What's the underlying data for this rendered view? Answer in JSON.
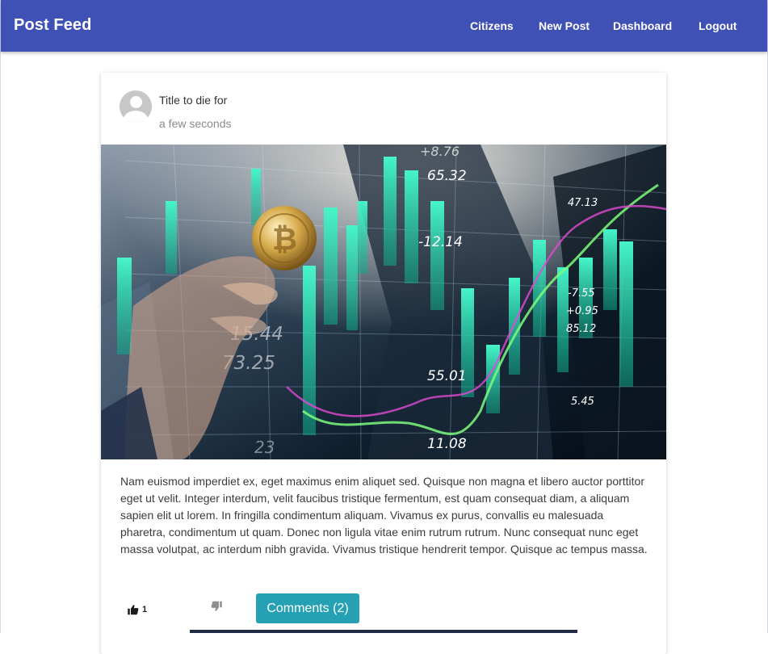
{
  "header": {
    "brand": "Post Feed",
    "nav": [
      "Citizens",
      "New Post",
      "Dashboard",
      "Logout"
    ],
    "background_color": "#3f51b5"
  },
  "post": {
    "title": "Title to die for",
    "time": "a few seconds",
    "avatar_icon": "default-user-avatar",
    "image_overlay_numbers": [
      "+8.76",
      "65.32",
      "-12.14",
      "47.13",
      "-7.55",
      "+0.95",
      "85.12",
      "15.44",
      "73.25",
      "55.01",
      "5.45",
      "11.08",
      "23"
    ],
    "body": "Nam euismod imperdiet ex, eget maximus enim aliquet sed. Quisque non magna et libero auctor porttitor eget ut velit. Integer interdum, velit faucibus tristique fermentum, est quam consequat diam, a aliquam sapien elit ut lorem. In fringilla condimentum aliquam. Vivamus ex purus, convallis eu malesuada pharetra, condimentum ut quam. Donec non ligula vitae enim rutrum rutrum. Nunc consequat nunc eget massa volutpat, ac interdum nibh gravida. Vivamus tristique hendrerit tempor. Quisque ac tempus massa.",
    "likes": "1",
    "like_icon": "thumbs-up-icon",
    "dislike_icon": "thumbs-down-icon",
    "comments_label": "Comments (2)",
    "accent_color": "#26a0b3"
  }
}
